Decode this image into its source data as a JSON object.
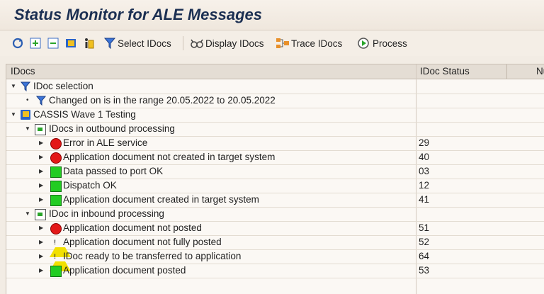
{
  "title": "Status Monitor for ALE Messages",
  "toolbar": {
    "buttons": [
      {
        "label": "Select IDocs",
        "icon": "filter-icon"
      },
      {
        "label": "Display IDocs",
        "icon": "glasses-icon"
      },
      {
        "label": "Trace IDocs",
        "icon": "trace-icon"
      },
      {
        "label": "Process",
        "icon": "process-icon"
      }
    ]
  },
  "columns": {
    "idocs": "IDocs",
    "status": "IDoc Status",
    "third": "Nu"
  },
  "rows": [
    {
      "label": "IDoc selection",
      "status": "",
      "icon": "filter-icon"
    },
    {
      "label": "Changed on is in the range 20.05.2022 to 20.05.2022",
      "status": "",
      "icon": "filter-icon"
    },
    {
      "label": "CASSIS Wave 1 Testing",
      "status": "",
      "icon": "folder-icon"
    },
    {
      "label": "IDocs in outbound processing",
      "status": "",
      "icon": "outbound-icon"
    },
    {
      "label": "Error in ALE service",
      "status": "29",
      "icon": "red-status-icon"
    },
    {
      "label": "Application document not created in target system",
      "status": "40",
      "icon": "red-status-icon"
    },
    {
      "label": "Data passed to port OK",
      "status": "03",
      "icon": "green-status-icon"
    },
    {
      "label": "Dispatch OK",
      "status": "12",
      "icon": "green-status-icon"
    },
    {
      "label": "Application document created in target system",
      "status": "41",
      "icon": "green-status-icon"
    },
    {
      "label": "IDoc in inbound processing",
      "status": "",
      "icon": "inbound-icon"
    },
    {
      "label": "Application document not posted",
      "status": "51",
      "icon": "red-status-icon"
    },
    {
      "label": "Application document not fully posted",
      "status": "52",
      "icon": "yellow-warning-icon"
    },
    {
      "label": "IDoc ready to be transferred to application",
      "status": "64",
      "icon": "yellow-warning-icon"
    },
    {
      "label": "Application document posted",
      "status": "53",
      "icon": "green-status-icon"
    }
  ]
}
